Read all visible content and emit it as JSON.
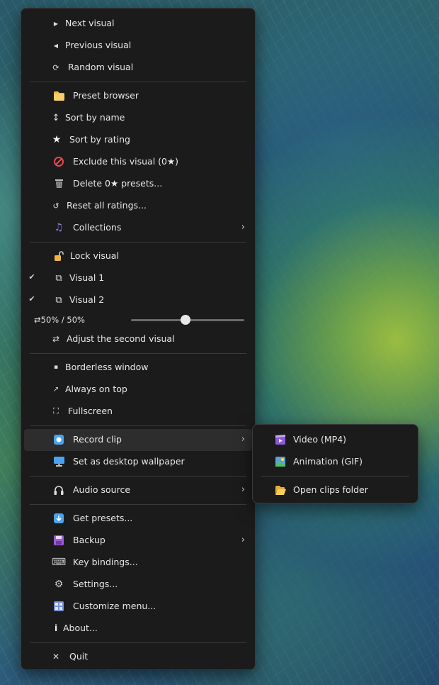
{
  "main_menu": {
    "items": {
      "next_visual": {
        "label": "Next visual",
        "icon": "play-icon",
        "glyph": "▶"
      },
      "previous_visual": {
        "label": "Previous visual",
        "icon": "back-icon",
        "glyph": "◀"
      },
      "random_visual": {
        "label": "Random visual",
        "icon": "shuffle-icon",
        "glyph": "⟳"
      },
      "preset_browser": {
        "label": "Preset browser",
        "icon": "folder-icon"
      },
      "sort_by_name": {
        "label": "Sort by name",
        "icon": "sort-icon",
        "glyph": "↕"
      },
      "sort_by_rating": {
        "label": "Sort by rating",
        "icon": "star-icon",
        "glyph": "★"
      },
      "exclude_visual": {
        "label": "Exclude this visual (0★)",
        "icon": "prohibited-icon"
      },
      "delete_presets": {
        "label": "Delete 0★ presets...",
        "icon": "trash-icon"
      },
      "reset_ratings": {
        "label": "Reset all ratings...",
        "icon": "reset-icon",
        "glyph": "↺"
      },
      "collections": {
        "label": "Collections",
        "icon": "music-icon",
        "glyph": "♫"
      },
      "lock_visual": {
        "label": "Lock visual",
        "icon": "unlock-icon"
      },
      "visual_1": {
        "label": "Visual 1",
        "icon": "copy-icon",
        "glyph": "⧉",
        "checked": true
      },
      "visual_2": {
        "label": "Visual 2",
        "icon": "copy-icon",
        "glyph": "⧉",
        "checked": true
      },
      "adjust_second": {
        "label": "Adjust the second visual",
        "icon": "swap-icon",
        "glyph": "⇄"
      },
      "borderless": {
        "label": "Borderless window",
        "icon": "window-icon",
        "glyph": "▪"
      },
      "always_on_top": {
        "label": "Always on top",
        "icon": "pin-icon",
        "glyph": "↗"
      },
      "fullscreen": {
        "label": "Fullscreen",
        "icon": "fullscreen-icon",
        "glyph": "⛶"
      },
      "record_clip": {
        "label": "Record clip",
        "icon": "record-icon"
      },
      "desktop_wallpaper": {
        "label": "Set as desktop wallpaper",
        "icon": "monitor-icon"
      },
      "audio_source": {
        "label": "Audio source",
        "icon": "headphones-icon",
        "glyph": "🎧"
      },
      "get_presets": {
        "label": "Get presets...",
        "icon": "download-icon",
        "glyph": "⬇"
      },
      "backup": {
        "label": "Backup",
        "icon": "floppy-icon"
      },
      "key_bindings": {
        "label": "Key bindings...",
        "icon": "keyboard-icon",
        "glyph": "⌨"
      },
      "settings": {
        "label": "Settings...",
        "icon": "gear-icon",
        "glyph": "⚙"
      },
      "customize_menu": {
        "label": "Customize menu...",
        "icon": "grid-icon"
      },
      "about": {
        "label": "About...",
        "icon": "info-icon",
        "glyph": "i"
      },
      "quit": {
        "label": "Quit",
        "icon": "close-icon",
        "glyph": "✕"
      }
    },
    "mix": {
      "icon": "swap-icon",
      "glyph": "⇄",
      "label": "50%  /  50%",
      "value": 0.5
    },
    "checkmark": "✔",
    "submenu_arrow": "›"
  },
  "sub_menu": {
    "video": {
      "label": "Video (MP4)",
      "icon": "video-icon"
    },
    "animation": {
      "label": "Animation (GIF)",
      "icon": "image-icon"
    },
    "open_folder": {
      "label": "Open clips folder",
      "icon": "folder-open-icon"
    }
  },
  "colors": {
    "menu_bg": "#1b1b1b",
    "highlight": "#2d2d2d",
    "accent_blue": "#4aa3f0",
    "folder_yellow": "#f2c14e"
  }
}
